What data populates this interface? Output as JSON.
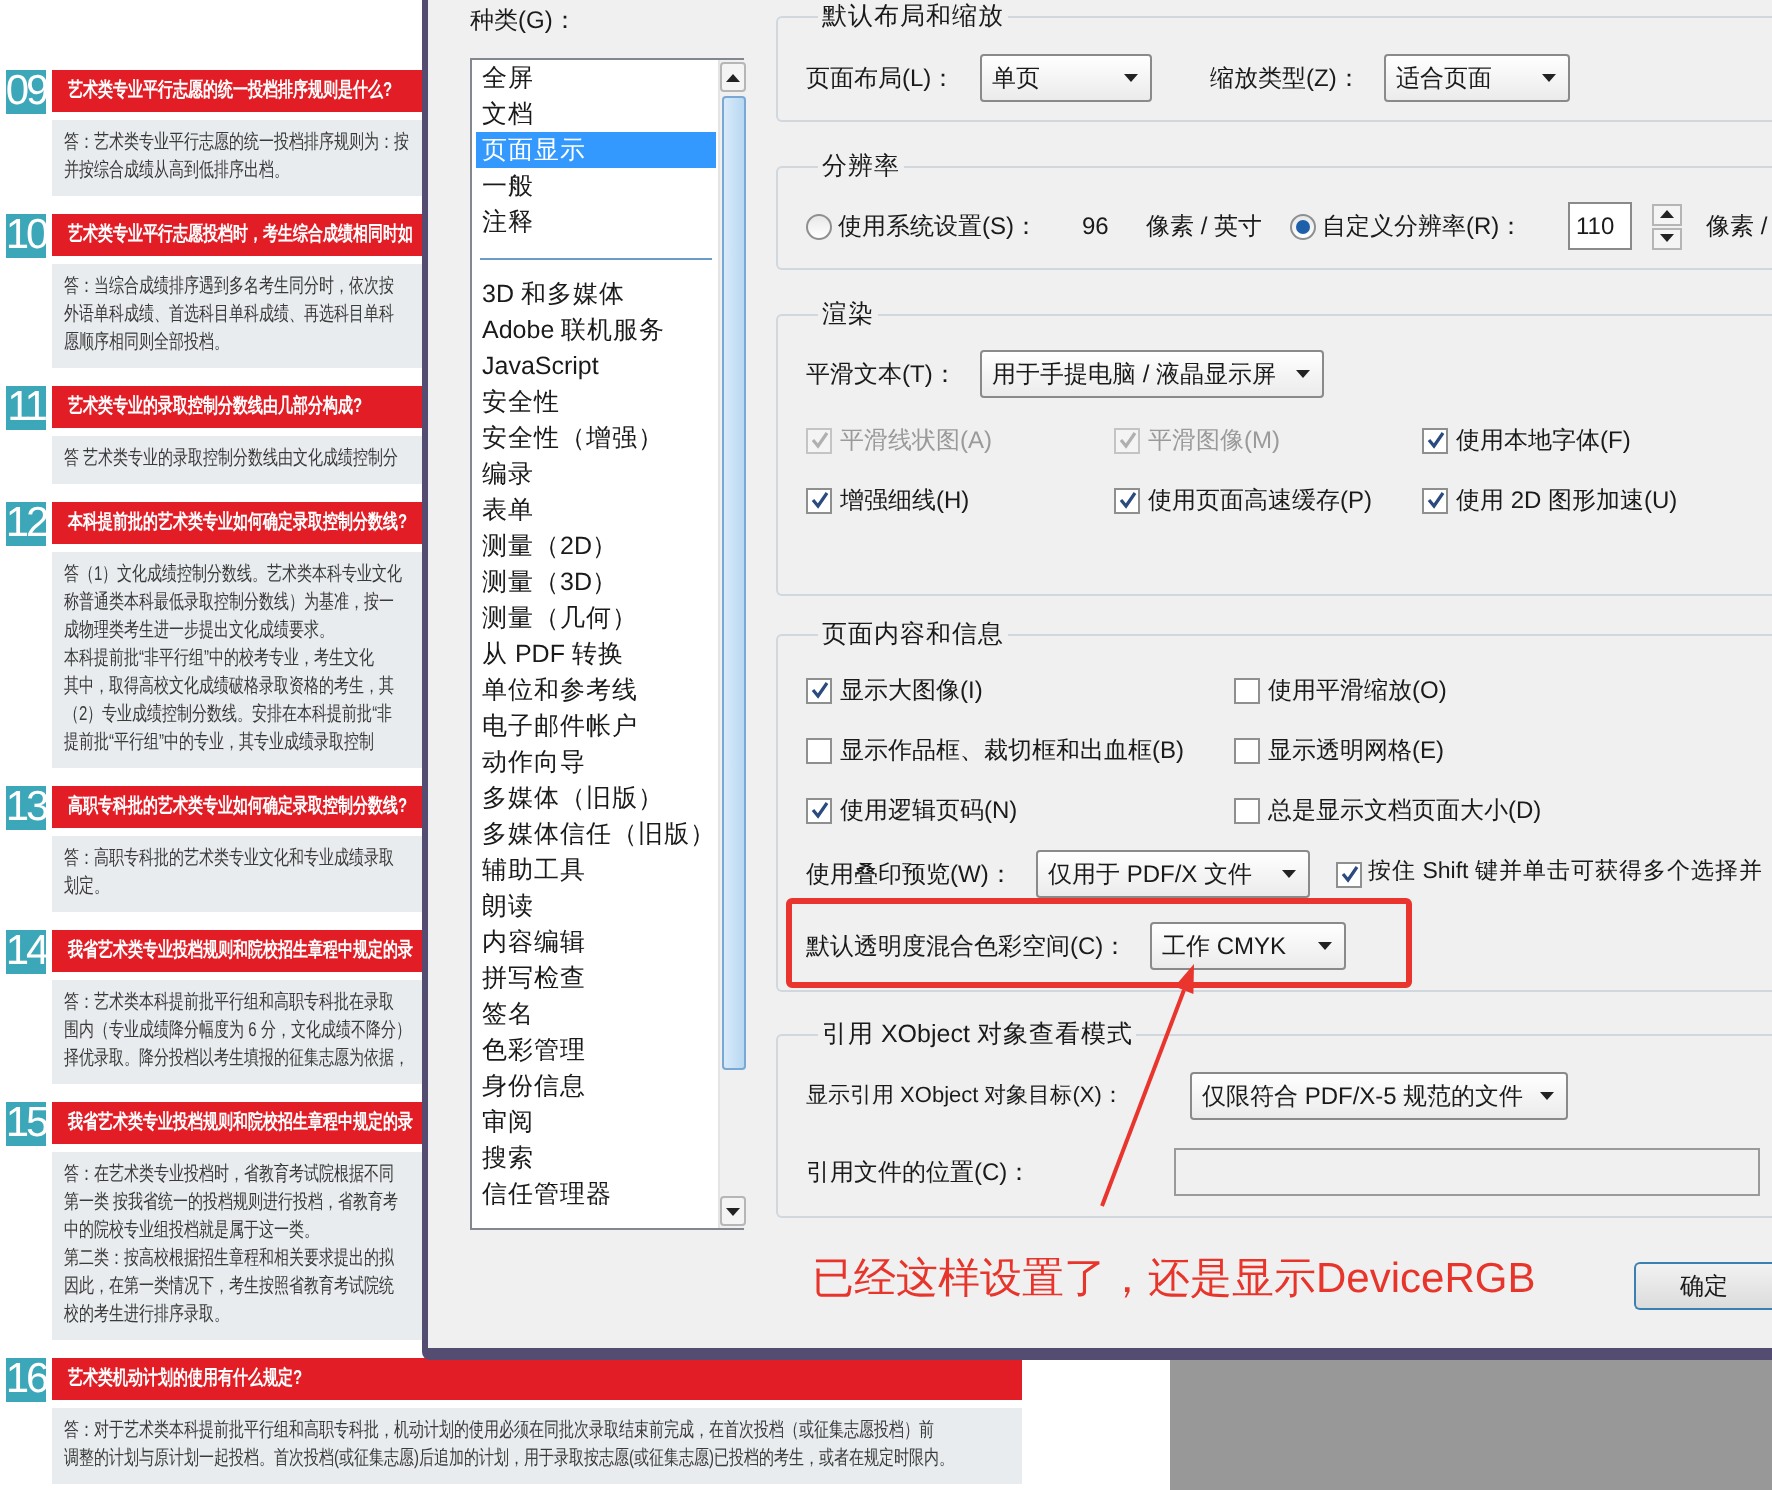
{
  "document": {
    "sections": [
      {
        "number": "09",
        "question": "艺术类专业平行志愿的统一投档排序规则是什么?",
        "answer_lines": [
          "答：艺术类专业平行志愿的统一投档排序规则为：按",
          "并按综合成绩从高到低排序出档。"
        ]
      },
      {
        "number": "10",
        "question": "艺术类专业平行志愿投档时，考生综合成绩相同时如",
        "answer_lines": [
          "答：当综合成绩排序遇到多名考生同分时，依次按",
          "外语单科成绩、首选科目单科成绩、再选科目单科",
          "愿顺序相同则全部投档。"
        ]
      },
      {
        "number": "11",
        "question": "艺术类专业的录取控制分数线由几部分构成?",
        "answer_lines": [
          "答 艺术类专业的录取控制分数线由文化成绩控制分"
        ]
      },
      {
        "number": "12",
        "question": "本科提前批的艺术类专业如何确定录取控制分数线?",
        "answer_lines": [
          "答（1）文化成绩控制分数线。艺术类本科专业文化",
          "称普通类本科最低录取控制分数线）为基准，按一",
          "成物理类考生进一步提出文化成绩要求。",
          "本科提前批“非平行组”中的校考专业，考生文化",
          "其中，取得高校文化成绩破格录取资格的考生，其",
          "（2）专业成绩控制分数线。安排在本科提前批“非",
          "提前批“平行组”中的专业，其专业成绩录取控制"
        ]
      },
      {
        "number": "13",
        "question": "高职专科批的艺术类专业如何确定录取控制分数线?",
        "answer_lines": [
          "答：高职专科批的艺术类专业文化和专业成绩录取",
          "划定。"
        ]
      },
      {
        "number": "14",
        "question": "我省艺术类专业投档规则和院校招生章程中规定的录",
        "answer_lines": [
          "答：艺术类本科提前批平行组和高职专科批在录取",
          "围内（专业成绩降分幅度为 6 分，文化成绩不降分）",
          "择优录取。降分投档以考生填报的征集志愿为依据，"
        ]
      },
      {
        "number": "15",
        "question": "我省艺术类专业投档规则和院校招生章程中规定的录",
        "answer_lines": [
          "答：在艺术类专业投档时，省教育考试院根据不同",
          "第一类 按我省统一的投档规则进行投档，省教育考",
          "中的院校专业组投档就是属于这一类。",
          "第二类：按高校根据招生章程和相关要求提出的拟",
          "因此，在第一类情况下，考生按照省教育考试院统",
          "校的考生进行排序录取。"
        ]
      },
      {
        "number": "16",
        "question": "艺术类机动计划的使用有什么规定?",
        "answer_lines": [
          "答：对于艺术类本科提前批平行组和高职专科批，机动计划的使用必须在同批次录取结束前完成，在首次投档（或征集志愿投档）前",
          "调整的计划与原计划一起投档。首次投档(或征集志愿)后追加的计划，用于录取按志愿(或征集志愿)已投档的考生，或者在规定时限内。"
        ]
      }
    ]
  },
  "dialog": {
    "category_label": "种类(G)：",
    "category_groups": [
      {
        "items": [
          {
            "label": "全屏",
            "selected": false
          },
          {
            "label": "文档",
            "selected": false
          },
          {
            "label": "页面显示",
            "selected": true
          },
          {
            "label": "一般",
            "selected": false
          },
          {
            "label": "注释",
            "selected": false
          }
        ]
      },
      {
        "items": [
          {
            "label": "3D 和多媒体",
            "selected": false
          },
          {
            "label": "Adobe 联机服务",
            "selected": false
          },
          {
            "label": "JavaScript",
            "selected": false
          },
          {
            "label": "安全性",
            "selected": false
          },
          {
            "label": "安全性（增强）",
            "selected": false
          },
          {
            "label": "编录",
            "selected": false
          },
          {
            "label": "表单",
            "selected": false
          },
          {
            "label": "测量（2D）",
            "selected": false
          },
          {
            "label": "测量（3D）",
            "selected": false
          },
          {
            "label": "测量（几何）",
            "selected": false
          },
          {
            "label": "从 PDF 转换",
            "selected": false
          },
          {
            "label": "单位和参考线",
            "selected": false
          },
          {
            "label": "电子邮件帐户",
            "selected": false
          },
          {
            "label": "动作向导",
            "selected": false
          },
          {
            "label": "多媒体（旧版）",
            "selected": false
          },
          {
            "label": "多媒体信任（旧版）",
            "selected": false
          },
          {
            "label": "辅助工具",
            "selected": false
          },
          {
            "label": "朗读",
            "selected": false
          },
          {
            "label": "内容编辑",
            "selected": false
          },
          {
            "label": "拼写检查",
            "selected": false
          },
          {
            "label": "签名",
            "selected": false
          },
          {
            "label": "色彩管理",
            "selected": false
          },
          {
            "label": "身份信息",
            "selected": false
          },
          {
            "label": "审阅",
            "selected": false
          },
          {
            "label": "搜索",
            "selected": false
          },
          {
            "label": "信任管理器",
            "selected": false
          }
        ]
      }
    ],
    "groups": [
      {
        "title": "默认布局和缩放",
        "rows": [
          {
            "kind": "selects",
            "items": [
              {
                "label": "页面布局(L)：",
                "value": "单页"
              },
              {
                "label": "缩放类型(Z)：",
                "value": "适合页面"
              }
            ]
          }
        ]
      },
      {
        "title": "分辨率",
        "rows": [
          {
            "kind": "resolution",
            "options": [
              {
                "label": "使用系统设置(S)：",
                "selected": false,
                "value": "96",
                "unit": "像素 / 英寸"
              },
              {
                "label": "自定义分辨率(R)：",
                "selected": true,
                "value": "110",
                "unit": "像素 /"
              }
            ]
          }
        ]
      },
      {
        "title": "渲染",
        "rows": [
          {
            "kind": "selects",
            "items": [
              {
                "label": "平滑文本(T)：",
                "value": "用于手提电脑 / 液晶显示屏"
              }
            ]
          },
          {
            "kind": "checks",
            "items": [
              {
                "label": "平滑线状图(A)",
                "checked": true,
                "disabled": true
              },
              {
                "label": "平滑图像(M)",
                "checked": true,
                "disabled": true
              },
              {
                "label": "使用本地字体(F)",
                "checked": true,
                "disabled": false
              }
            ]
          },
          {
            "kind": "checks",
            "items": [
              {
                "label": "增强细线(H)",
                "checked": true,
                "disabled": false
              },
              {
                "label": "使用页面高速缓存(P)",
                "checked": true,
                "disabled": false
              },
              {
                "label": "使用 2D 图形加速(U)",
                "checked": true,
                "disabled": false
              }
            ]
          }
        ]
      },
      {
        "title": "页面内容和信息",
        "rows": [
          {
            "kind": "checks",
            "items": [
              {
                "label": "显示大图像(I)",
                "checked": true,
                "disabled": false
              },
              {
                "label": "使用平滑缩放(O)",
                "checked": false,
                "disabled": false
              }
            ]
          },
          {
            "kind": "checks",
            "items": [
              {
                "label": "显示作品框、裁切框和出血框(B)",
                "checked": false,
                "disabled": false
              },
              {
                "label": "显示透明网格(E)",
                "checked": false,
                "disabled": false
              }
            ]
          },
          {
            "kind": "checks",
            "items": [
              {
                "label": "使用逻辑页码(N)",
                "checked": true,
                "disabled": false
              },
              {
                "label": "总是显示文档页面大小(D)",
                "checked": false,
                "disabled": false
              }
            ]
          },
          {
            "kind": "select_check",
            "label": "使用叠印预览(W)：",
            "value": "仅用于 PDF/X 文件",
            "check": {
              "label": "按住 Shift 键并单击可获得多个选择并",
              "checked": true
            }
          },
          {
            "kind": "selects",
            "items": [
              {
                "label": "默认透明度混合色彩空间(C)：",
                "value": "工作 CMYK"
              }
            ]
          }
        ]
      },
      {
        "title": "引用 XObject 对象查看模式",
        "rows": [
          {
            "kind": "selects",
            "items": [
              {
                "label": "显示引用 XObject 对象目标(X)：",
                "value": "仅限符合 PDF/X-5 规范的文件"
              }
            ]
          },
          {
            "kind": "input",
            "label": "引用文件的位置(C)：",
            "disabled": true
          }
        ]
      }
    ],
    "ok_button": "确定"
  },
  "annotation": {
    "text": "已经这样设置了，还是显示DeviceRGB"
  }
}
